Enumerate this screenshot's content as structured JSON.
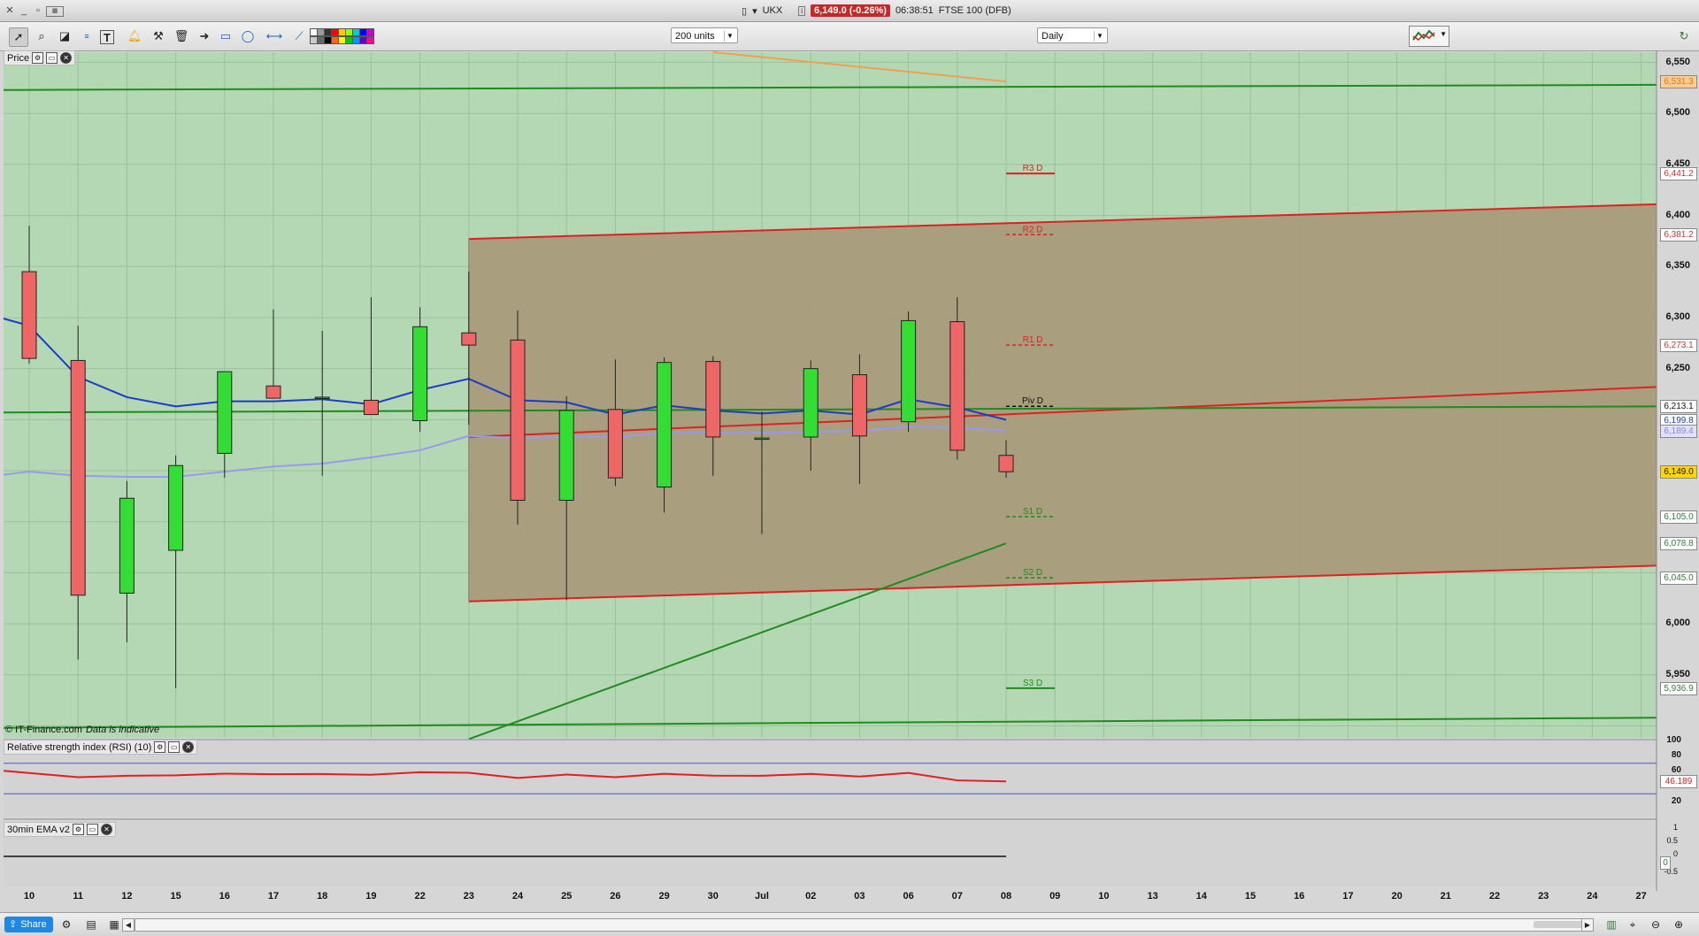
{
  "window": {
    "instrument_code": "UKX",
    "price_badge": "6,149.0 (-0.26%)",
    "time": "06:38:51",
    "instrument_name": "FTSE 100 (DFB)"
  },
  "toolbar": {
    "units_select": "200 units",
    "period_select": "Daily",
    "tools": [
      "pointer-icon",
      "magnifier-icon",
      "chart-icon",
      "text-icon",
      "alert-bell-icon",
      "measure-icon",
      "trash-icon",
      "arrow-icon",
      "rectangle-icon",
      "ellipse-icon",
      "horizontal-line-icon",
      "trend-line-icon"
    ],
    "swatches": [
      "#ffffff",
      "#cccccc",
      "#999999",
      "#666666",
      "#333333",
      "#000000",
      "#ff0000",
      "#ff6600",
      "#ffcc00",
      "#ffff00",
      "#99ff00",
      "#00cc00",
      "#00cccc",
      "#0099ff",
      "#0000ff",
      "#6600cc",
      "#cc00cc",
      "#ff0099"
    ]
  },
  "price_panel": {
    "label": "Price",
    "credit": "© IT-Finance.com",
    "credit_note": "Data is indicative",
    "y_axis_labels": [
      "6,550",
      "6,500",
      "6,450",
      "6,400",
      "6,350",
      "6,300",
      "6,250",
      "6,000",
      "5,950"
    ],
    "axis_tags": [
      {
        "text": "6,531.3",
        "bg": "#ffcc99",
        "fg": "#e07b00"
      },
      {
        "text": "6,441.2",
        "bg": "#ffffff",
        "fg": "#d32f2f"
      },
      {
        "text": "6,381.2",
        "bg": "#ffffff",
        "fg": "#d32f2f"
      },
      {
        "text": "6,273.1",
        "bg": "#ffffff",
        "fg": "#d32f2f"
      },
      {
        "text": "6,213.1",
        "bg": "#ffffff",
        "fg": "#111111"
      },
      {
        "text": "6,199.8",
        "bg": "#ffffff",
        "fg": "#1a3cc8"
      },
      {
        "text": "6,189.4",
        "bg": "#e0e0ff",
        "fg": "#8888dd"
      },
      {
        "text": "6,149.0",
        "bg": "#ffd600",
        "fg": "#111111"
      },
      {
        "text": "6,105.0",
        "bg": "#ffffff",
        "fg": "#2e7d32"
      },
      {
        "text": "6,078.8",
        "bg": "#ffffff",
        "fg": "#2e7d32"
      },
      {
        "text": "6,045.0",
        "bg": "#ffffff",
        "fg": "#2e7d32"
      },
      {
        "text": "5,936.9",
        "bg": "#ffffff",
        "fg": "#2e7d32"
      }
    ],
    "pivot_labels": [
      "R3 D",
      "R2 D",
      "R1 D",
      "Piv D",
      "S1 D",
      "S2 D",
      "S3 D"
    ]
  },
  "rsi_panel": {
    "label": "Relative strength index (RSI) (10)",
    "axis_labels": [
      "100",
      "80",
      "60",
      "20"
    ],
    "value_tag": "46.189"
  },
  "ema_panel": {
    "label": "30min EMA v2",
    "axis_labels": [
      "1",
      "0.5",
      "0",
      "-0.5"
    ],
    "value_tag": "0"
  },
  "x_axis": [
    "10",
    "11",
    "12",
    "15",
    "16",
    "17",
    "18",
    "19",
    "22",
    "23",
    "24",
    "25",
    "26",
    "29",
    "30",
    "Jul",
    "02",
    "03",
    "06",
    "07",
    "08",
    "09",
    "10",
    "13",
    "14",
    "15",
    "16",
    "17",
    "20",
    "21",
    "22",
    "23",
    "24",
    "27"
  ],
  "bottom": {
    "share_label": "Share"
  },
  "chart_data": {
    "type": "candlestick",
    "period": "Daily",
    "dates": [
      "10",
      "11",
      "12",
      "15",
      "16",
      "17",
      "18",
      "19",
      "22",
      "23",
      "24",
      "25",
      "26",
      "29",
      "30",
      "Jul",
      "02",
      "03",
      "06",
      "07",
      "08"
    ],
    "candles": [
      {
        "date": "10",
        "open": 6345,
        "high": 6390,
        "low": 6255,
        "close": 6260
      },
      {
        "date": "11",
        "open": 6258,
        "high": 6292,
        "low": 5965,
        "close": 6028
      },
      {
        "date": "12",
        "open": 6030,
        "high": 6140,
        "low": 5982,
        "close": 6123
      },
      {
        "date": "15",
        "open": 6072,
        "high": 6165,
        "low": 5937,
        "close": 6155
      },
      {
        "date": "16",
        "open": 6167,
        "high": 6203,
        "low": 6143,
        "close": 6247
      },
      {
        "date": "17",
        "open": 6233,
        "high": 6308,
        "low": 6222,
        "close": 6221
      },
      {
        "date": "18",
        "open": 6221,
        "high": 6287,
        "low": 6145,
        "close": 6222
      },
      {
        "date": "19",
        "open": 6219,
        "high": 6320,
        "low": 6208,
        "close": 6205
      },
      {
        "date": "22",
        "open": 6199,
        "high": 6310,
        "low": 6188,
        "close": 6291
      },
      {
        "date": "23",
        "open": 6285,
        "high": 6345,
        "low": 6195,
        "close": 6273
      },
      {
        "date": "24",
        "open": 6278,
        "high": 6307,
        "low": 6097,
        "close": 6121
      },
      {
        "date": "25",
        "open": 6121,
        "high": 6223,
        "low": 6023,
        "close": 6209
      },
      {
        "date": "26",
        "open": 6210,
        "high": 6259,
        "low": 6135,
        "close": 6143
      },
      {
        "date": "29",
        "open": 6134,
        "high": 6261,
        "low": 6109,
        "close": 6256
      },
      {
        "date": "30",
        "open": 6257,
        "high": 6262,
        "low": 6145,
        "close": 6183
      },
      {
        "date": "Jul",
        "open": 6182,
        "high": 6208,
        "low": 6088,
        "close": 6182
      },
      {
        "date": "02",
        "open": 6183,
        "high": 6258,
        "low": 6150,
        "close": 6250
      },
      {
        "date": "03",
        "open": 6244,
        "high": 6264,
        "low": 6137,
        "close": 6184
      },
      {
        "date": "06",
        "open": 6198,
        "high": 6306,
        "low": 6188,
        "close": 6297
      },
      {
        "date": "07",
        "open": 6296,
        "high": 6320,
        "low": 6161,
        "close": 6170
      },
      {
        "date": "08",
        "open": 6165,
        "high": 6180,
        "low": 6143,
        "close": 6149
      }
    ],
    "ma_blue": [
      6299,
      6292,
      6242,
      6222,
      6213,
      6218,
      6218,
      6220,
      6215,
      6229,
      6240,
      6219,
      6217,
      6205,
      6214,
      6209,
      6206,
      6209,
      6205,
      6220,
      6212,
      6199.8
    ],
    "ma_lavender": [
      6146,
      6149,
      6145,
      6144,
      6144,
      6149,
      6154,
      6157,
      6163,
      6170,
      6184,
      6182,
      6183,
      6183,
      6187,
      6187,
      6187,
      6188,
      6189,
      6193,
      6192,
      6189.4
    ],
    "pivots": {
      "R3": 6441.2,
      "R2": 6381.2,
      "R1": 6273.1,
      "Piv": 6213.1,
      "S1": 6105.0,
      "S2": 6045.0,
      "S3": 5936.9
    },
    "y_range": [
      5890,
      6560
    ],
    "colors": {
      "up": "#33dd33",
      "down": "#ee6666",
      "ma_blue": "#1a3cc8",
      "ma_lavender": "#9999ee",
      "channel_red": "#e02020",
      "channel_green": "#1e8c1e"
    },
    "rsi": [
      60.2,
      57.3,
      51.8,
      53.6,
      54.2,
      56.4,
      55.7,
      55.9,
      54.9,
      58.3,
      57.5,
      50.8,
      55.2,
      51.7,
      56.2,
      53.8,
      53.6,
      56.1,
      52.6,
      57.4,
      47.6,
      46.189
    ],
    "rsi_range": [
      0,
      100
    ]
  }
}
